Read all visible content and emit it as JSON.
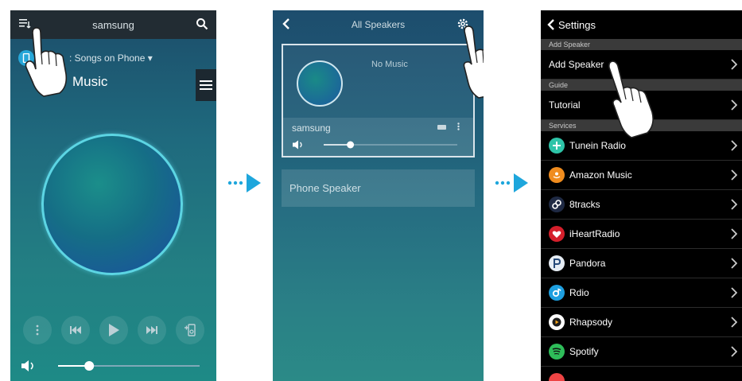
{
  "screen1": {
    "app_title": "samsung",
    "source_text": ": Songs on Phone ▾",
    "playlist_title": "Music",
    "icons": [
      "queue-icon",
      "search-icon",
      "phone-icon",
      "menu-icon",
      "more-icon",
      "prev-icon",
      "play-icon",
      "next-icon",
      "speaker-add-icon",
      "volume-icon"
    ],
    "volume_level": 0.22
  },
  "screen2": {
    "header_title": "All Speakers",
    "card": {
      "now_playing": "No Music",
      "speaker_name": "samsung",
      "volume_level": 0.2
    },
    "phone_speaker_label": "Phone Speaker",
    "icons": [
      "back-icon",
      "gear-icon",
      "battery-icon",
      "more-icon",
      "volume-icon"
    ]
  },
  "screen3": {
    "header_title": "Settings",
    "sections": [
      {
        "title": "Add Speaker",
        "items": [
          {
            "label": "Add Speaker"
          }
        ]
      },
      {
        "title": "Guide",
        "items": [
          {
            "label": "Tutorial"
          }
        ]
      },
      {
        "title": "Services",
        "items": [
          {
            "label": "Tunein Radio",
            "icon": "tunein-icon",
            "color": "#2ec4a8"
          },
          {
            "label": "Amazon Music",
            "icon": "amazon-icon",
            "color": "#f08c1e"
          },
          {
            "label": "8tracks",
            "icon": "8tracks-icon",
            "color": "#1f2a44"
          },
          {
            "label": "iHeartRadio",
            "icon": "iheartradio-icon",
            "color": "#d51f2b"
          },
          {
            "label": "Pandora",
            "icon": "pandora-icon",
            "color": "#e6edf4"
          },
          {
            "label": "Rdio",
            "icon": "rdio-icon",
            "color": "#1e9fe0"
          },
          {
            "label": "Rhapsody",
            "icon": "rhapsody-icon",
            "color": "#ffffff"
          },
          {
            "label": "Spotify",
            "icon": "spotify-icon",
            "color": "#2ebd59"
          }
        ]
      }
    ]
  },
  "colors": {
    "arrow": "#1ea6dc",
    "accent": "#5cd5e3"
  }
}
